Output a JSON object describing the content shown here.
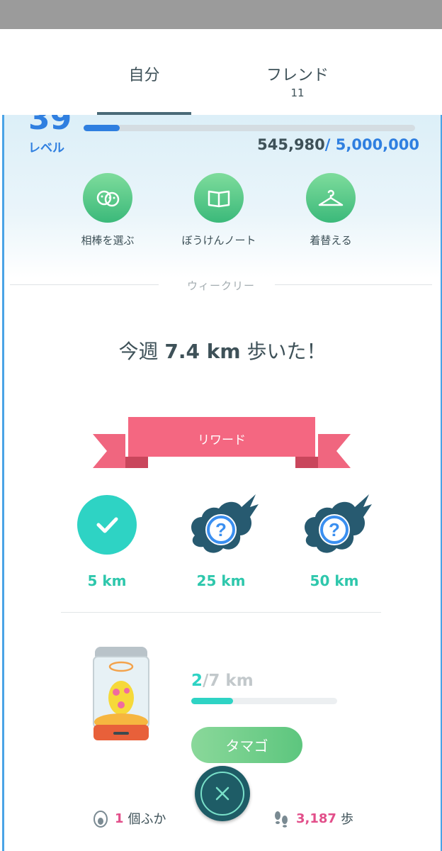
{
  "tabs": [
    {
      "label": "自分",
      "count": ""
    },
    {
      "label": "フレンド",
      "count": "11"
    }
  ],
  "profile": {
    "level": "39",
    "level_label": "レベル",
    "xp_current": "545,980",
    "xp_total": "/ 5,000,000",
    "xp_progress": 0.109
  },
  "actions": [
    {
      "label": "相棒を選ぶ",
      "icon": "buddy-icon"
    },
    {
      "label": "ぼうけんノート",
      "icon": "journal-icon"
    },
    {
      "label": "着替える",
      "icon": "hanger-icon"
    }
  ],
  "weekly": {
    "section_label": "ウィークリー",
    "walked_prefix": "今週",
    "walked_distance": "7.4 km",
    "walked_suffix": "歩いた！",
    "reward_label": "リワード",
    "milestones": [
      {
        "label": "5 km",
        "state": "completed",
        "icon": "check-icon"
      },
      {
        "label": "25 km",
        "state": "locked",
        "icon": "mystery-reward-icon"
      },
      {
        "label": "50 km",
        "state": "locked",
        "icon": "mystery-reward-icon"
      }
    ]
  },
  "egg": {
    "progress_current": "2",
    "progress_total": "/7 km",
    "progress_fraction": 0.2857,
    "button_label": "タマゴ"
  },
  "footer": {
    "hatched_count": "1",
    "hatched_label": "個ふか",
    "steps_count": "3,187",
    "steps_label": "歩"
  },
  "colors": {
    "accent_blue": "#2f7fe0",
    "teal": "#2ed3c4",
    "ribbon_pink": "#f0667f",
    "green": "#5dc67e",
    "pink_number": "#e24f8a"
  }
}
